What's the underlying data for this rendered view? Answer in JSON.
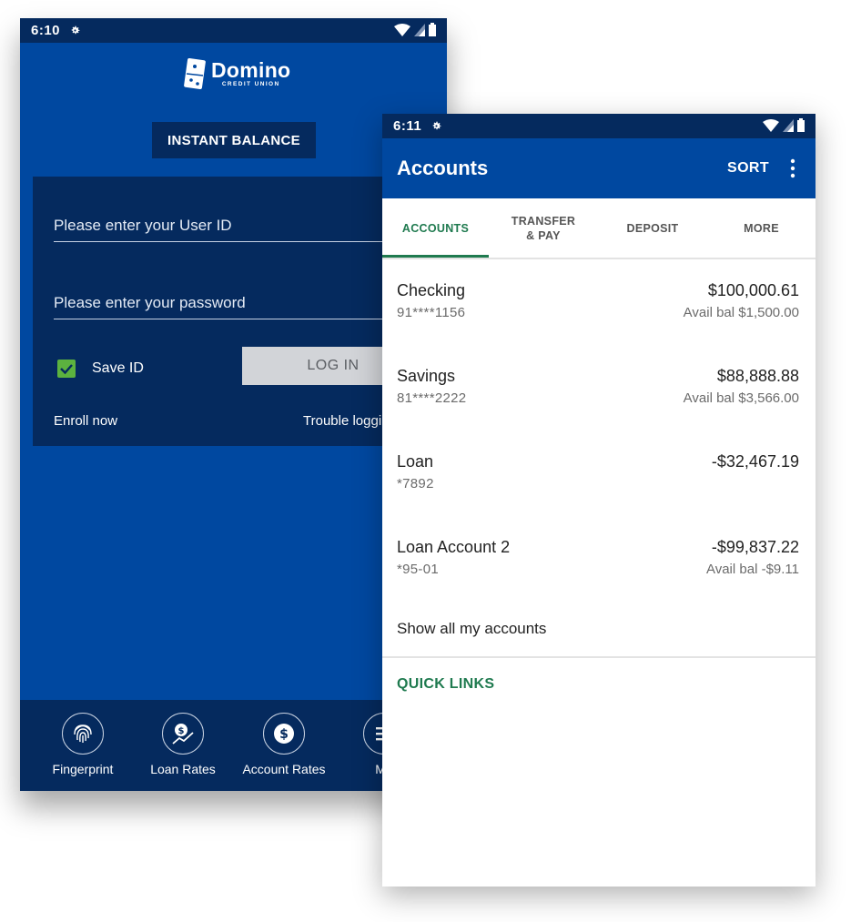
{
  "login_screen": {
    "status_time": "6:10",
    "logo_name": "Domino",
    "logo_sub": "CREDIT UNION",
    "instant_balance_label": "INSTANT BALANCE",
    "userid_placeholder": "Please enter your User ID",
    "password_placeholder": "Please enter your password",
    "save_id_label": "Save ID",
    "save_id_checked": true,
    "login_label": "LOG IN",
    "enroll_label": "Enroll now",
    "trouble_label": "Trouble loggi",
    "nav": [
      {
        "label": "Fingerprint",
        "icon": "fingerprint-icon"
      },
      {
        "label": "Loan Rates",
        "icon": "loan-rates-icon"
      },
      {
        "label": "Account Rates",
        "icon": "dollar-icon"
      },
      {
        "label": "Mo",
        "icon": "menu-icon"
      }
    ]
  },
  "accounts_screen": {
    "status_time": "6:11",
    "title": "Accounts",
    "sort_label": "SORT",
    "tabs": [
      {
        "label": "ACCOUNTS",
        "active": true
      },
      {
        "label": "TRANSFER & PAY",
        "active": false
      },
      {
        "label": "DEPOSIT",
        "active": false
      },
      {
        "label": "MORE",
        "active": false
      }
    ],
    "accounts": [
      {
        "name": "Checking",
        "number": "91****1156",
        "balance": "$100,000.61",
        "avail": "Avail bal $1,500.00"
      },
      {
        "name": "Savings",
        "number": "81****2222",
        "balance": "$88,888.88",
        "avail": "Avail bal $3,566.00"
      },
      {
        "name": "Loan",
        "number": "*7892",
        "balance": "-$32,467.19",
        "avail": ""
      },
      {
        "name": "Loan Account 2",
        "number": "*95-01",
        "balance": "-$99,837.22",
        "avail": "Avail bal -$9.11"
      }
    ],
    "show_all_label": "Show all my accounts",
    "quick_links_label": "QUICK LINKS"
  },
  "colors": {
    "brand_blue": "#0048a0",
    "dark_navy": "#052a5e",
    "accent_green": "#1f7a4f",
    "checkbox_green": "#5cb23f"
  }
}
